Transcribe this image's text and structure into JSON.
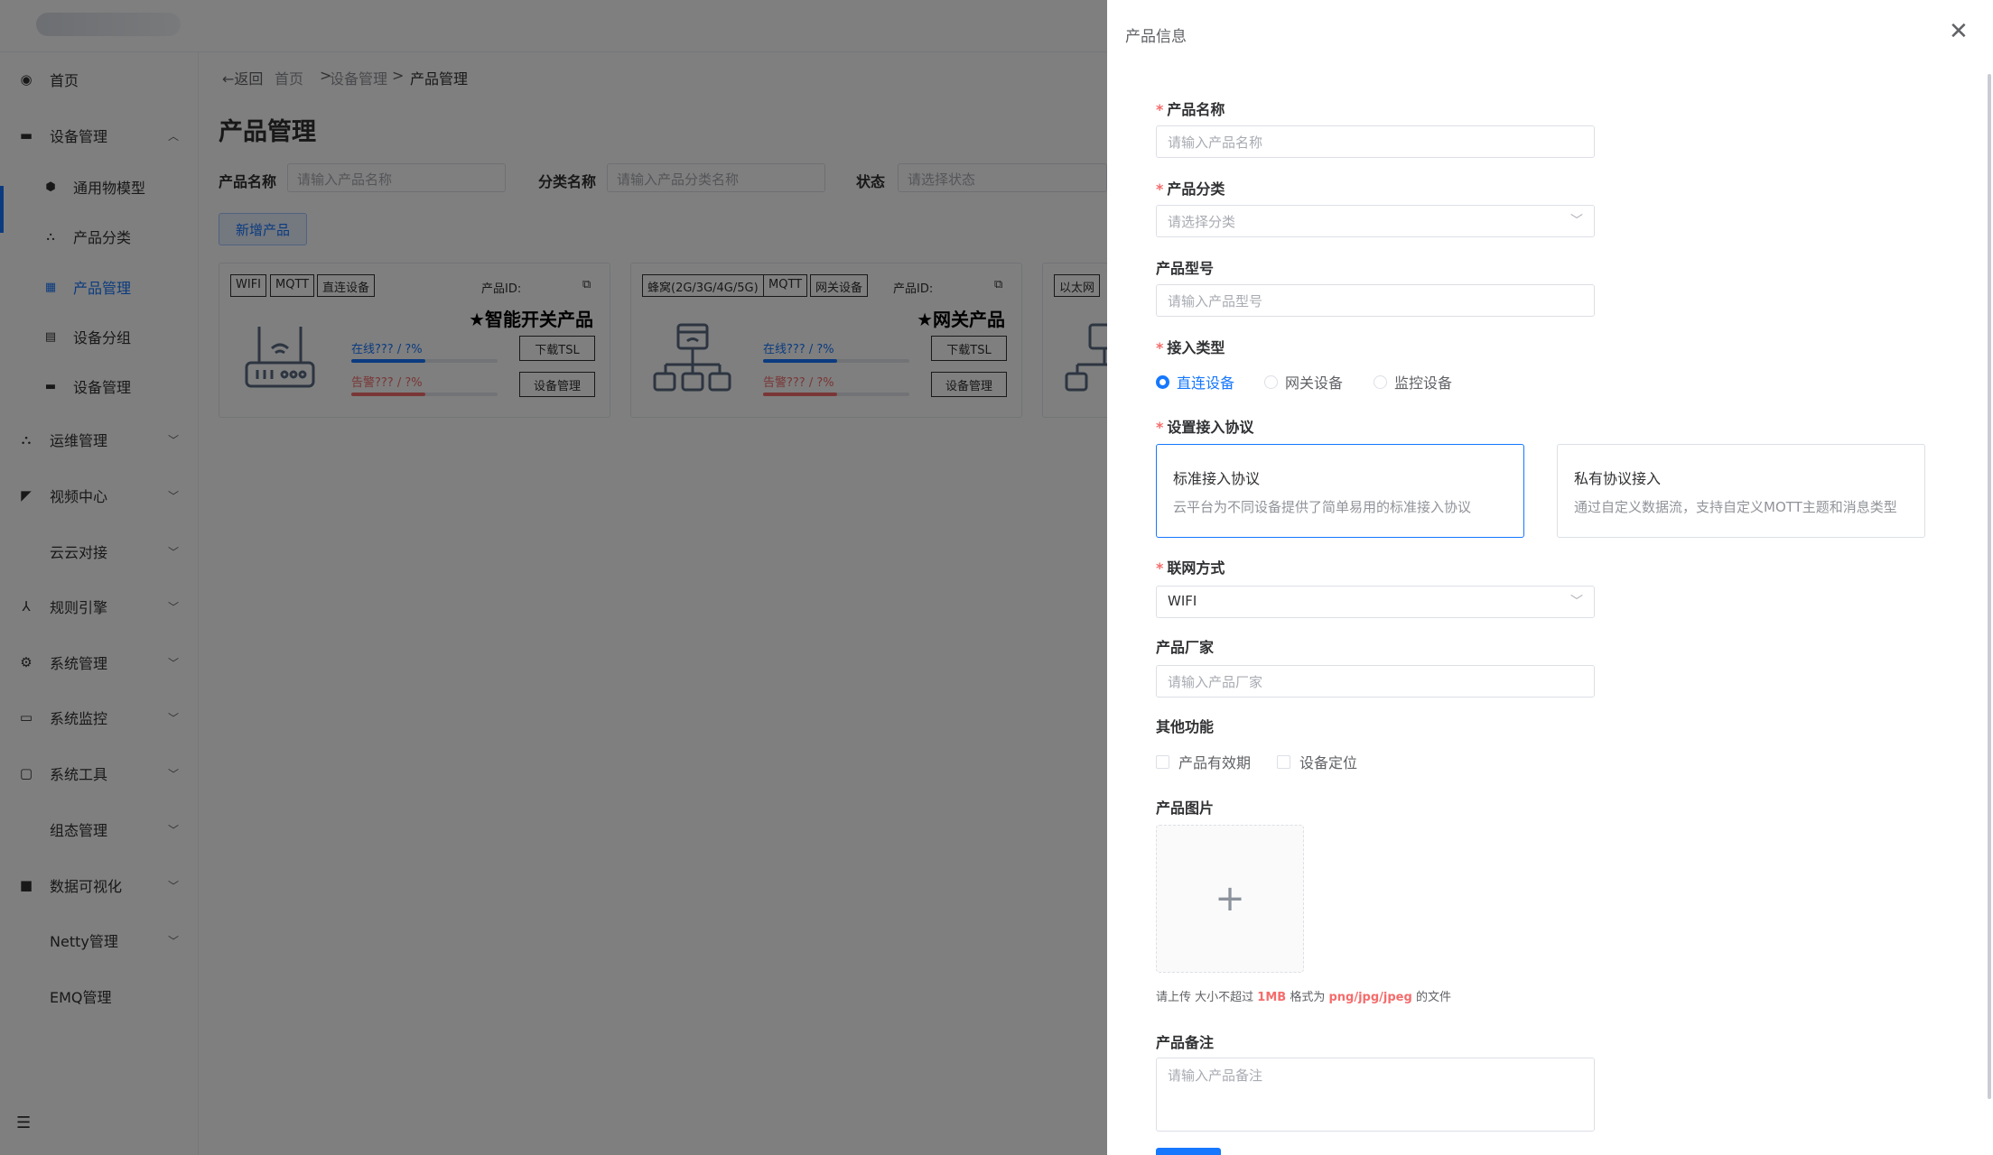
{
  "sidebar": {
    "items": [
      {
        "label": "首页",
        "icon": "dashboard-icon",
        "glyph": "◉",
        "arrow": ""
      },
      {
        "label": "设备管理",
        "icon": "device-icon",
        "glyph": "▬",
        "arrow": "︿"
      },
      {
        "label": "通用物模型",
        "icon": "model-icon",
        "glyph": "⬢",
        "arrow": ""
      },
      {
        "label": "产品分类",
        "icon": "category-icon",
        "glyph": "⛬",
        "arrow": ""
      },
      {
        "label": "产品管理",
        "icon": "grid-icon",
        "glyph": "▦",
        "arrow": ""
      },
      {
        "label": "设备分组",
        "icon": "group-icon",
        "glyph": "▤",
        "arrow": ""
      },
      {
        "label": "设备管理",
        "icon": "device-list-icon",
        "glyph": "▬",
        "arrow": ""
      },
      {
        "label": "运维管理",
        "icon": "ops-icon",
        "glyph": "⛬",
        "arrow": "﹀"
      },
      {
        "label": "视频中心",
        "icon": "camera-icon",
        "glyph": "◤",
        "arrow": "﹀"
      },
      {
        "label": "云云对接",
        "icon": "cloud-icon",
        "glyph": "",
        "arrow": "﹀"
      },
      {
        "label": "规则引擎",
        "icon": "rule-icon",
        "glyph": "⅄",
        "arrow": "﹀"
      },
      {
        "label": "系统管理",
        "icon": "gear-icon",
        "glyph": "⚙",
        "arrow": "﹀"
      },
      {
        "label": "系统监控",
        "icon": "monitor-icon",
        "glyph": "▭",
        "arrow": "﹀"
      },
      {
        "label": "系统工具",
        "icon": "toolbox-icon",
        "glyph": "▢",
        "arrow": "﹀"
      },
      {
        "label": "组态管理",
        "icon": "config-icon",
        "glyph": "",
        "arrow": "﹀"
      },
      {
        "label": "数据可视化",
        "icon": "chart-icon",
        "glyph": "■",
        "arrow": "﹀"
      },
      {
        "label": "Netty管理",
        "icon": "netty-icon",
        "glyph": "",
        "arrow": "﹀"
      },
      {
        "label": "EMQ管理",
        "icon": "emq-icon",
        "glyph": "",
        "arrow": ""
      }
    ],
    "toggle_glyph": "☰"
  },
  "breadcrumb": {
    "back": "←返回",
    "home": "首页",
    "sep1": ">",
    "level2": "设备管理",
    "sep2": ">",
    "current": "产品管理"
  },
  "page": {
    "title": "产品管理",
    "filters": {
      "name_label": "产品名称",
      "name_placeholder": "请输入产品名称",
      "category_label": "分类名称",
      "category_placeholder": "请输入产品分类名称",
      "status_label": "状态",
      "status_placeholder": "请选择状态"
    },
    "add_button": "新增产品"
  },
  "cards": [
    {
      "tags": [
        "WIFI",
        "MQTT",
        "直连设备"
      ],
      "id_label": "产品ID:",
      "name": "★智能开关产品",
      "online": "在线??? / ?%",
      "alarm": "告警??? / ?%",
      "btn_tsl": "下载TSL",
      "btn_manage": "设备管理"
    },
    {
      "tags": [
        "蜂窝(2G/3G/4G/5G)",
        "MQTT",
        "网关设备"
      ],
      "id_label": "产品ID:",
      "name": "★网关产品",
      "online": "在线??? / ?%",
      "alarm": "告警??? / ?%",
      "btn_tsl": "下载TSL",
      "btn_manage": "设备管理"
    },
    {
      "tags": [
        "以太网"
      ],
      "id_label": "",
      "name": "",
      "online": "",
      "alarm": "",
      "btn_tsl": "",
      "btn_manage": ""
    }
  ],
  "drawer": {
    "title": "产品信息",
    "close_glyph": "✕",
    "required_mark": "*",
    "fields": {
      "name_label": "产品名称",
      "name_placeholder": "请输入产品名称",
      "category_label": "产品分类",
      "category_placeholder": "请选择分类",
      "model_label": "产品型号",
      "model_placeholder": "请输入产品型号",
      "access_label": "接入类型",
      "access_options": [
        "直连设备",
        "网关设备",
        "监控设备"
      ],
      "access_selected": "直连设备",
      "protocol_label": "设置接入协议",
      "protocol_cards": [
        {
          "title": "标准接入协议",
          "desc": "云平台为不同设备提供了简单易用的标准接入协议",
          "selected": true
        },
        {
          "title": "私有协议接入",
          "desc": "通过自定义数据流，支持自定义MOTT主题和消息类型",
          "selected": false
        }
      ],
      "network_label": "联网方式",
      "network_value": "WIFI",
      "vendor_label": "产品厂家",
      "vendor_placeholder": "请输入产品厂家",
      "other_label": "其他功能",
      "other_options": [
        "产品有效期",
        "设备定位"
      ],
      "image_label": "产品图片",
      "upload_glyph": "+",
      "upload_tip_prefix": "请上传 大小不超过",
      "upload_tip_size": "1MB",
      "upload_tip_mid": "格式为",
      "upload_tip_format": "png/jpg/jpeg",
      "upload_tip_suffix": "的文件",
      "remark_label": "产品备注",
      "remark_placeholder": "请输入产品备注"
    },
    "select_arrow": "﹀"
  },
  "colors": {
    "primary": "#1677ff",
    "danger": "#f56c6c",
    "overlay": "rgba(0,0,0,0.5)"
  }
}
